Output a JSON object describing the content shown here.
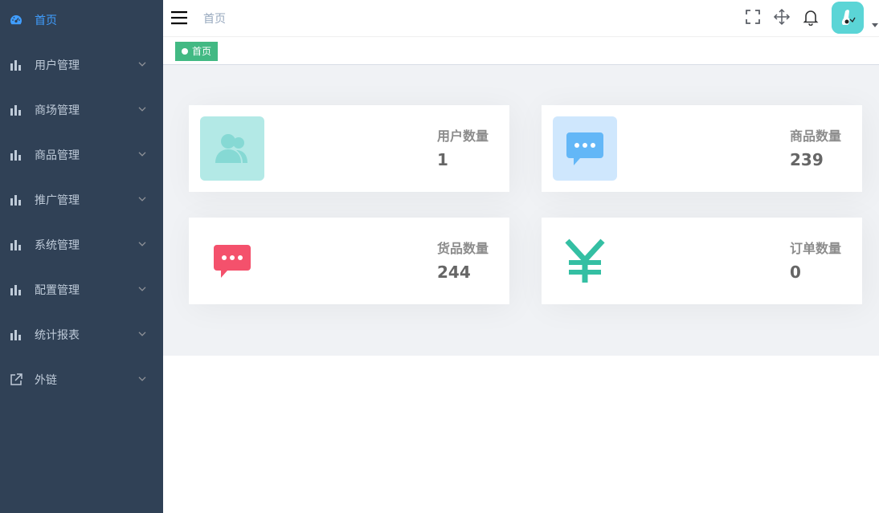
{
  "sidebar": {
    "bg": "#304156",
    "active_color": "#409eff",
    "items": [
      {
        "label": "首页",
        "icon": "dashboard-icon",
        "active": true
      },
      {
        "label": "用户管理",
        "icon": "bar-chart-icon"
      },
      {
        "label": "商场管理",
        "icon": "bar-chart-icon"
      },
      {
        "label": "商品管理",
        "icon": "bar-chart-icon"
      },
      {
        "label": "推广管理",
        "icon": "bar-chart-icon"
      },
      {
        "label": "系统管理",
        "icon": "bar-chart-icon"
      },
      {
        "label": "配置管理",
        "icon": "bar-chart-icon"
      },
      {
        "label": "统计报表",
        "icon": "bar-chart-icon"
      },
      {
        "label": "外链",
        "icon": "external-link-icon"
      }
    ]
  },
  "header": {
    "breadcrumb": "首页",
    "icons": [
      "fullscreen-icon",
      "size-move-icon",
      "bell-icon",
      "avatar"
    ]
  },
  "tags": [
    {
      "label": "首页",
      "active": true,
      "color": "#42b983"
    }
  ],
  "dashboard": {
    "cards": [
      {
        "title": "用户数量",
        "value": "1",
        "icon": "users-icon",
        "icon_bg": "#b3e9e6",
        "icon_color": "#86d9d4"
      },
      {
        "title": "商品数量",
        "value": "239",
        "icon": "message-icon",
        "icon_bg": "#cfe7fd",
        "icon_color": "#63b7f7"
      },
      {
        "title": "货品数量",
        "value": "244",
        "icon": "message-icon",
        "icon_bg": "#ffffff",
        "icon_color": "#f4516c"
      },
      {
        "title": "订单数量",
        "value": "0",
        "icon": "yen-icon",
        "icon_bg": "#ffffff",
        "icon_color": "#34bfa3"
      }
    ]
  }
}
